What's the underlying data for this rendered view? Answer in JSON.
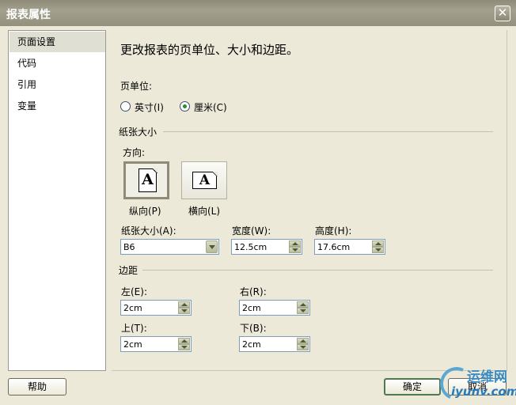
{
  "window": {
    "title": "报表属性",
    "close_glyph": "✕"
  },
  "nav": {
    "items": [
      {
        "label": "页面设置",
        "selected": true
      },
      {
        "label": "代码"
      },
      {
        "label": "引用"
      },
      {
        "label": "变量"
      }
    ]
  },
  "main": {
    "heading": "更改报表的页单位、大小和边距。",
    "unit": {
      "label": "页单位:",
      "options": [
        {
          "label": "英寸(I)",
          "checked": false
        },
        {
          "label": "厘米(C)",
          "checked": true
        }
      ]
    },
    "paper": {
      "group_title": "纸张大小",
      "orientation_label": "方向:",
      "portrait_label": "纵向(P)",
      "landscape_label": "横向(L)",
      "icon_letter": "A",
      "size_label": "纸张大小(A):",
      "size_value": "B6",
      "width_label": "宽度(W):",
      "width_value": "12.5cm",
      "height_label": "高度(H):",
      "height_value": "17.6cm"
    },
    "margins": {
      "group_title": "边距",
      "left_label": "左(E):",
      "left_value": "2cm",
      "right_label": "右(R):",
      "right_value": "2cm",
      "top_label": "上(T):",
      "top_value": "2cm",
      "bottom_label": "下(B):",
      "bottom_value": "2cm"
    }
  },
  "footer": {
    "help_label": "帮助",
    "ok_label": "确定",
    "cancel_label": "取消"
  },
  "watermark": {
    "line1": "运维网",
    "line2": "iyunv.com"
  }
}
